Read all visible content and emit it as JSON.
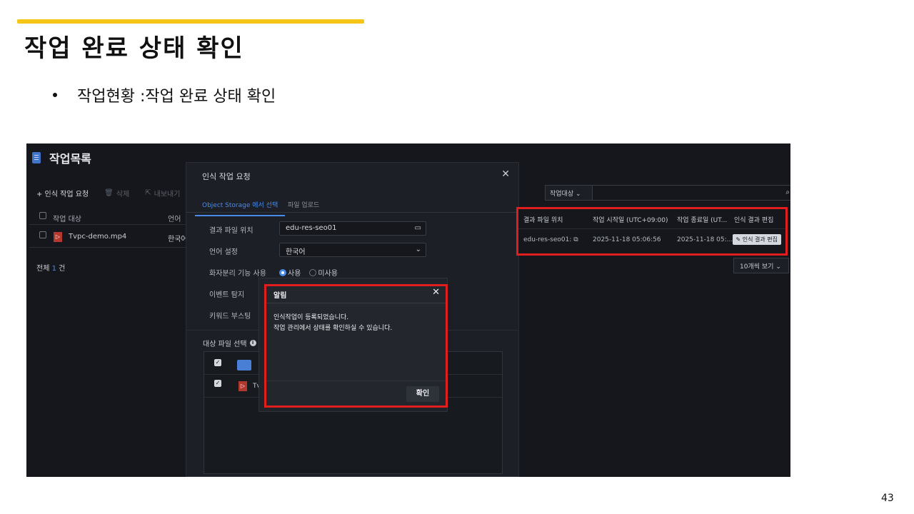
{
  "slide": {
    "title": "작업 완료 상태 확인",
    "bullet": "작업현황 :작업 완료 상태 확인",
    "page_number": "43",
    "accent_color": "#f5c518"
  },
  "app": {
    "page_title": "작업목록",
    "toolbar": {
      "new_request": "+ 인식 작업 요청",
      "delete": "삭제",
      "export": "내보내기"
    },
    "left_table": {
      "headers": [
        "작업 대상",
        "언어"
      ],
      "rows": [
        {
          "file": "Tvpc-demo.mp4",
          "language": "한국어"
        }
      ],
      "total_prefix": "전체",
      "total_count": "1",
      "total_suffix": "건"
    },
    "request_panel": {
      "title": "인식 작업 요청",
      "tabs": [
        "Object Storage 에서 선택",
        "파일 업로드"
      ],
      "labels": {
        "result_location": "결과 파일 위치",
        "language": "언어 설정",
        "diarization": "화자분리 기능 사용",
        "event": "이벤트 탐지",
        "keyword": "키워드 부스팅"
      },
      "result_location_value": "edu-res-seo01",
      "language_value": "한국어",
      "diarization_options": [
        "사용",
        "미사용"
      ],
      "file_select_title": "대상 파일 선택",
      "file_rows": [
        "",
        "Tv"
      ]
    },
    "search": {
      "scope": "작업대상"
    },
    "right_table": {
      "headers": [
        "결과 파일 위치",
        "작업 시작일 (UTC+09:00)",
        "작업 종료일 (UT...",
        "인식 결과 편집"
      ],
      "row": {
        "location": "edu-res-seo01:",
        "start": "2025-11-18 05:06:56",
        "end": "2025-11-18 05:...",
        "edit": "인식 결과 편집"
      }
    },
    "page_size": "10개씩 보기",
    "alert": {
      "title": "알림",
      "line1": "인식작업이 등록되었습니다.",
      "line2": "작업 관리에서 상태를 확인하실 수 있습니다.",
      "confirm": "확인"
    }
  }
}
